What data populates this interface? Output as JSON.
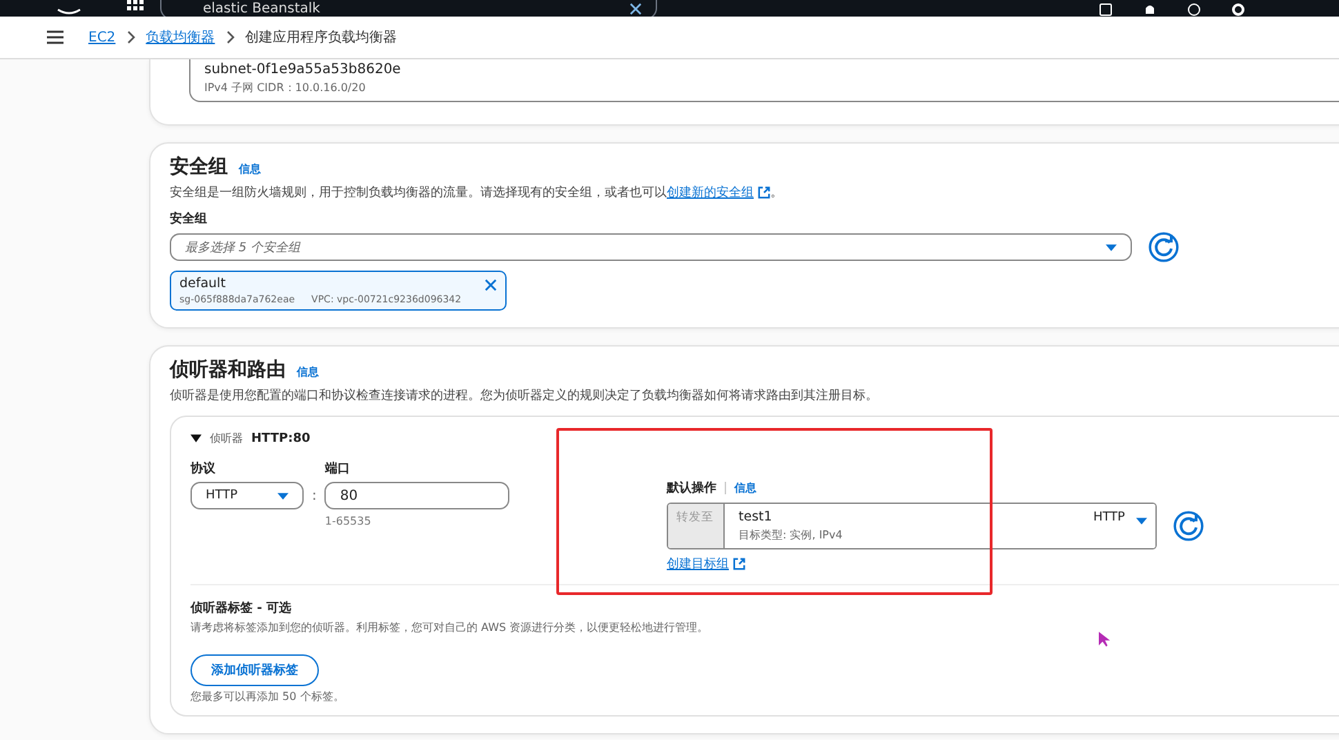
{
  "topbar": {
    "search_value": "elastic Beanstalk"
  },
  "breadcrumb": [
    {
      "label": "EC2",
      "link": true
    },
    {
      "label": "负载均衡器",
      "link": true
    },
    {
      "label": "创建应用程序负载均衡器",
      "link": false
    }
  ],
  "subnet": {
    "id": "subnet-0f1e9a55a53b8620e",
    "cidr": "IPv4 子网 CIDR：10.0.16.0/20"
  },
  "security_group": {
    "title": "安全组",
    "info": "信息",
    "description": "安全组是一组防火墙规则，用于控制负载均衡器的流量。请选择现有的安全组，或者也可以",
    "description_link": "创建新的安全组",
    "description_end": "。",
    "field_label": "安全组",
    "placeholder": "最多选择 5 个安全组",
    "chips": [
      {
        "name": "default",
        "id": "sg-065f888da7a762eae",
        "vpc": "VPC: vpc-00721c9236d096342"
      }
    ]
  },
  "listeners": {
    "title": "侦听器和路由",
    "info": "信息",
    "description": "侦听器是使用您配置的端口和协议检查连接请求的进程。您为侦听器定义的规则决定了负载均衡器如何将请求路由到其注册目标。",
    "items": [
      {
        "label": "侦听器",
        "name": "HTTP:80",
        "expanded": true,
        "protocol_label": "协议",
        "protocol": "HTTP",
        "separator": ":",
        "port_label": "端口",
        "port": "80",
        "port_hint": "1-65535",
        "action_label": "默认操作",
        "action_info": "信息",
        "forward_label": "转发至",
        "target_name": "test1",
        "target_type": "目标类型: 实例, IPv4",
        "target_protocol": "HTTP",
        "create_link": "创建目标组",
        "tags_title": "侦听器标签 - 可选",
        "tags_description": "请考虑将标签添加到您的侦听器。利用标签，您可对自己的 AWS 资源进行分类，以便更轻松地进行管理。",
        "add_button": "添加侦听器标签",
        "add_hint": "您最多可以再添加 50 个标签。"
      }
    ]
  }
}
